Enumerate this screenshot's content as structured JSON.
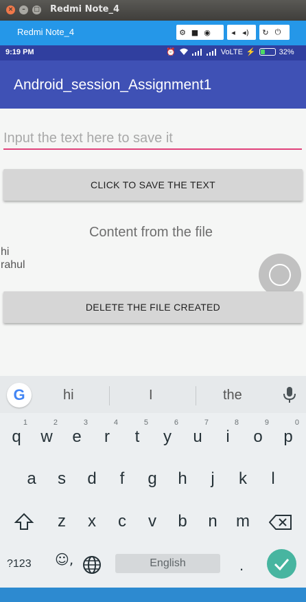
{
  "window": {
    "title": "Redmi Note_4",
    "close_glyph": "×",
    "min_glyph": "–",
    "max_glyph": "□"
  },
  "toolbar": {
    "title": "Redmi Note_4",
    "icons": [
      "gear-icon",
      "video-camera-icon",
      "camera-icon",
      "volume-down-icon",
      "volume-up-icon",
      "rotate-icon",
      "power-icon"
    ],
    "icon_glyphs": {
      "gear": "⚙",
      "video": "■",
      "camera": "◉",
      "voldown": "◂",
      "volup": "◂)",
      "rotate": "↻",
      "power": "⏻"
    }
  },
  "statusbar": {
    "time": "9:19 PM",
    "network": "VoLTE",
    "battery": "32%",
    "battery_level": 0.32,
    "charging_glyph": "⚡",
    "alarm_glyph": "⏰"
  },
  "app": {
    "title": "Android_session_Assignment1",
    "accent": "#3f51b5"
  },
  "main": {
    "input_placeholder": "Input the text here to save it",
    "save_button": "CLICK TO SAVE THE TEXT",
    "content_label": "Content from the file",
    "file_content": "hi\nrahul",
    "delete_button": "DELETE THE FILE CREATED"
  },
  "keyboard": {
    "google_logo": "G",
    "suggestions": [
      "hi",
      "I",
      "the"
    ],
    "row1": [
      {
        "key": "q",
        "hint": "1"
      },
      {
        "key": "w",
        "hint": "2"
      },
      {
        "key": "e",
        "hint": "3"
      },
      {
        "key": "r",
        "hint": "4"
      },
      {
        "key": "t",
        "hint": "5"
      },
      {
        "key": "y",
        "hint": "6"
      },
      {
        "key": "u",
        "hint": "7"
      },
      {
        "key": "i",
        "hint": "8"
      },
      {
        "key": "o",
        "hint": "9"
      },
      {
        "key": "p",
        "hint": "0"
      }
    ],
    "row2": [
      "a",
      "s",
      "d",
      "f",
      "g",
      "h",
      "j",
      "k",
      "l"
    ],
    "row3": [
      "z",
      "x",
      "c",
      "v",
      "b",
      "n",
      "m"
    ],
    "symbols_key": "?123",
    "emoji_key": "☺,",
    "space_label": "English",
    "period_key": "."
  }
}
